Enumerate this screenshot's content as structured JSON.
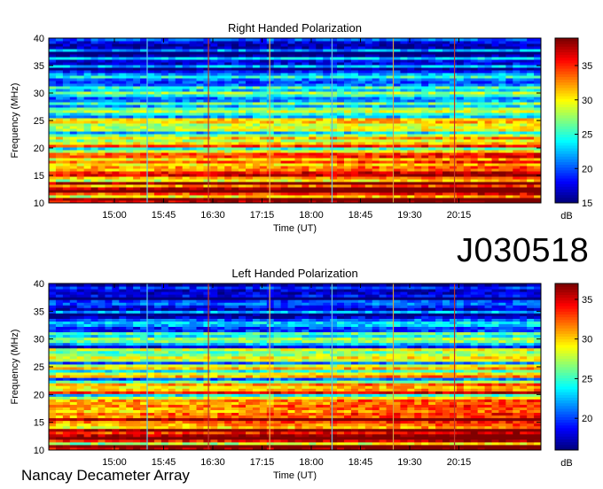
{
  "observation_id": "J030518",
  "observatory": "Nancay Decameter Array",
  "chart_data": [
    {
      "type": "heatmap",
      "title": "Right Handed Polarization",
      "xlabel": "Time (UT)",
      "ylabel": "Frequency (MHz)",
      "x_range_minutes": [
        840,
        1290
      ],
      "xticks": [
        "15:00",
        "15:45",
        "16:30",
        "17:15",
        "18:00",
        "18:45",
        "19:30",
        "20:15"
      ],
      "xtick_minutes": [
        900,
        945,
        990,
        1035,
        1080,
        1125,
        1170,
        1215
      ],
      "ylim": [
        10,
        40
      ],
      "yticks": [
        10,
        15,
        20,
        25,
        30,
        35,
        40
      ],
      "colorbar": {
        "label": "dB",
        "range": [
          15,
          39
        ],
        "ticks": [
          15,
          20,
          25,
          30,
          35
        ]
      },
      "vertical_lines": [
        {
          "time_minutes": 930,
          "color": "#55ccee"
        },
        {
          "time_minutes": 986,
          "color": "#c0342a"
        },
        {
          "time_minutes": 1042,
          "color": "#e8b050"
        },
        {
          "time_minutes": 1099,
          "color": "#66bbdd"
        },
        {
          "time_minutes": 1155,
          "color": "#d8a040"
        },
        {
          "time_minutes": 1211,
          "color": "#c0342a"
        }
      ]
    },
    {
      "type": "heatmap",
      "title": "Left Handed Polarization",
      "xlabel": "Time (UT)",
      "ylabel": "Frequency (MHz)",
      "x_range_minutes": [
        840,
        1290
      ],
      "xticks": [
        "15:00",
        "15:45",
        "16:30",
        "17:15",
        "18:00",
        "18:45",
        "19:30",
        "20:15"
      ],
      "xtick_minutes": [
        900,
        945,
        990,
        1035,
        1080,
        1125,
        1170,
        1215
      ],
      "ylim": [
        10,
        40
      ],
      "yticks": [
        10,
        15,
        20,
        25,
        30,
        35,
        40
      ],
      "colorbar": {
        "label": "dB",
        "range": [
          16,
          37
        ],
        "ticks": [
          20,
          25,
          30,
          35
        ]
      },
      "vertical_lines": [
        {
          "time_minutes": 930,
          "color": "#55ccee"
        },
        {
          "time_minutes": 986,
          "color": "#c0342a"
        },
        {
          "time_minutes": 1042,
          "color": "#e8b050"
        },
        {
          "time_minutes": 1099,
          "color": "#66bbdd"
        },
        {
          "time_minutes": 1155,
          "color": "#d8a040"
        },
        {
          "time_minutes": 1211,
          "color": "#c0342a"
        }
      ]
    }
  ]
}
